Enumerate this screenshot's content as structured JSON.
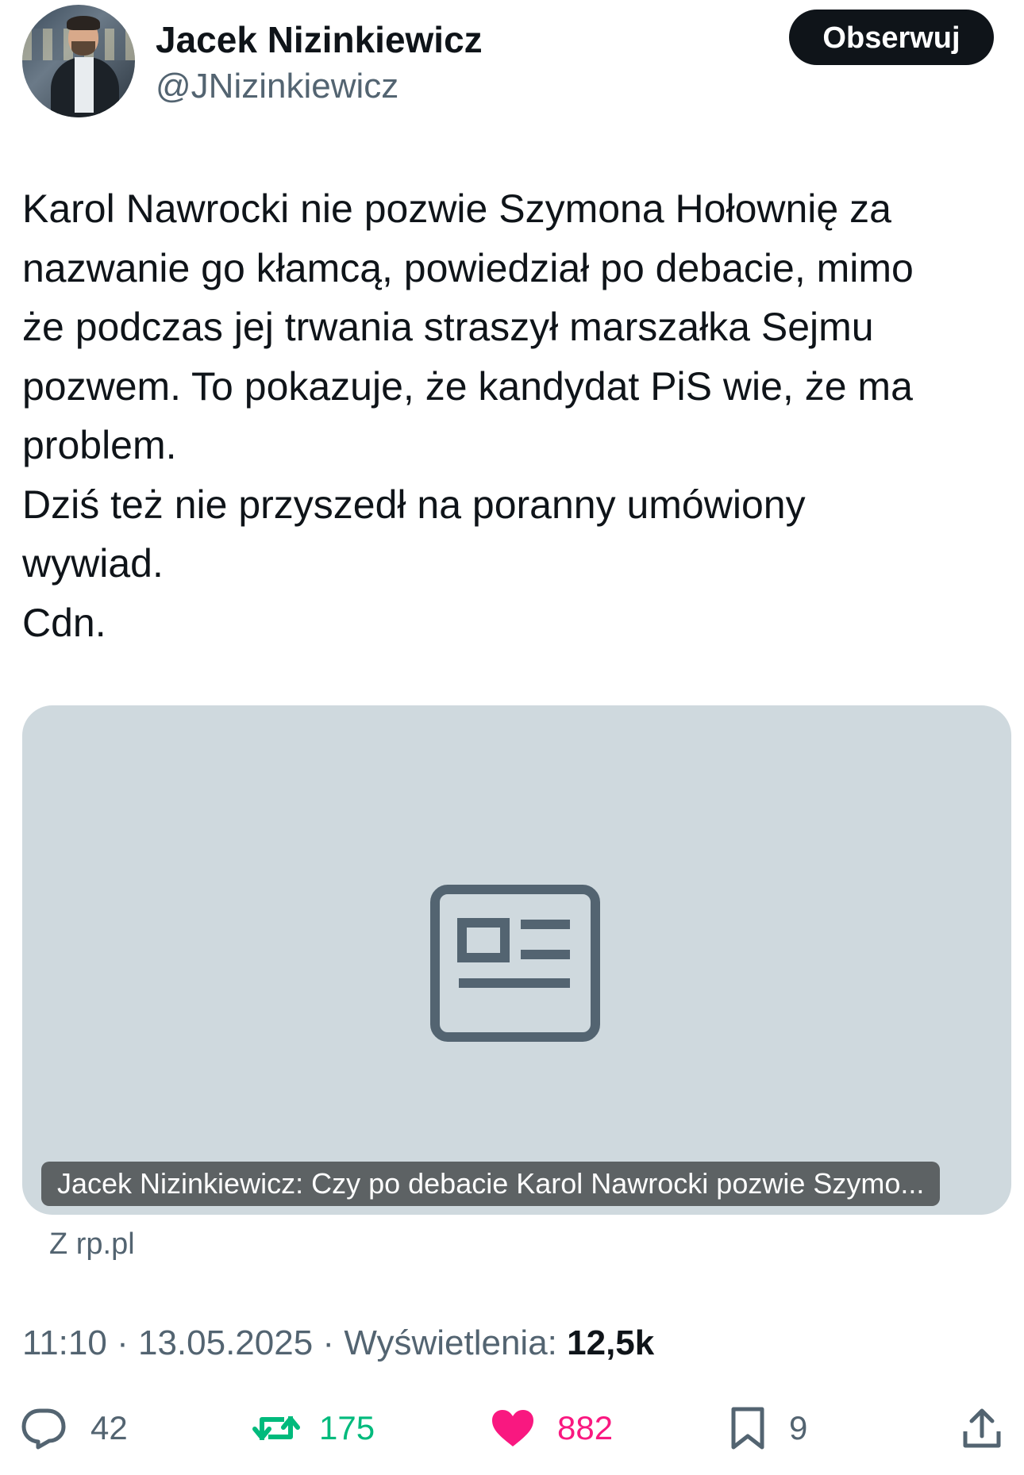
{
  "author": {
    "name": "Jacek Nizinkiewicz",
    "handle": "@JNizinkiewicz",
    "follow_label": "Obserwuj"
  },
  "tweet": {
    "text": "Karol Nawrocki nie pozwie Szymona Hołownię za\nnazwanie go kłamcą, powiedział po debacie, mimo\nże podczas jej trwania straszył marszałka Sejmu\npozwem. To pokazuje, że kandydat PiS wie, że ma\nproblem.\nDziś też nie przyszedł na poranny umówiony\nwywiad.\nCdn."
  },
  "link_card": {
    "icon": "article-icon",
    "title": "Jacek Nizinkiewicz: Czy po debacie Karol Nawrocki pozwie Szymo...",
    "source": "Z rp.pl"
  },
  "meta": {
    "time": "11:10",
    "date": "13.05.2025",
    "views_label": "Wyświetlenia:",
    "views_count": "12,5k",
    "separator": "·"
  },
  "actions": {
    "replies": "42",
    "retweets": "175",
    "likes": "882",
    "bookmarks": "9"
  },
  "colors": {
    "text": "#0f1419",
    "secondary": "#536471",
    "retweet": "#00ba7c",
    "like": "#f91880",
    "card_bg": "#cfd9de"
  }
}
